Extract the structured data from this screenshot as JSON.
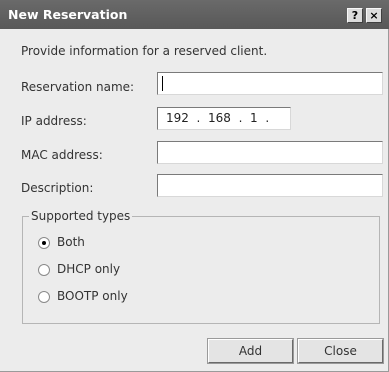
{
  "window": {
    "title": "New Reservation",
    "help_button": "?",
    "close_button": "×"
  },
  "intro": "Provide information for a reserved client.",
  "fields": {
    "reservation_name": {
      "label": "Reservation name:",
      "value": ""
    },
    "ip_address": {
      "label": "IP address:",
      "octets": [
        "192",
        "168",
        "1",
        ""
      ]
    },
    "mac_address": {
      "label": "MAC address:",
      "value": ""
    },
    "description": {
      "label": "Description:",
      "value": ""
    }
  },
  "supported_types": {
    "legend": "Supported types",
    "options": [
      {
        "label": "Both",
        "selected": true
      },
      {
        "label": "DHCP only",
        "selected": false
      },
      {
        "label": "BOOTP only",
        "selected": false
      }
    ]
  },
  "buttons": {
    "add": "Add",
    "close": "Close"
  }
}
